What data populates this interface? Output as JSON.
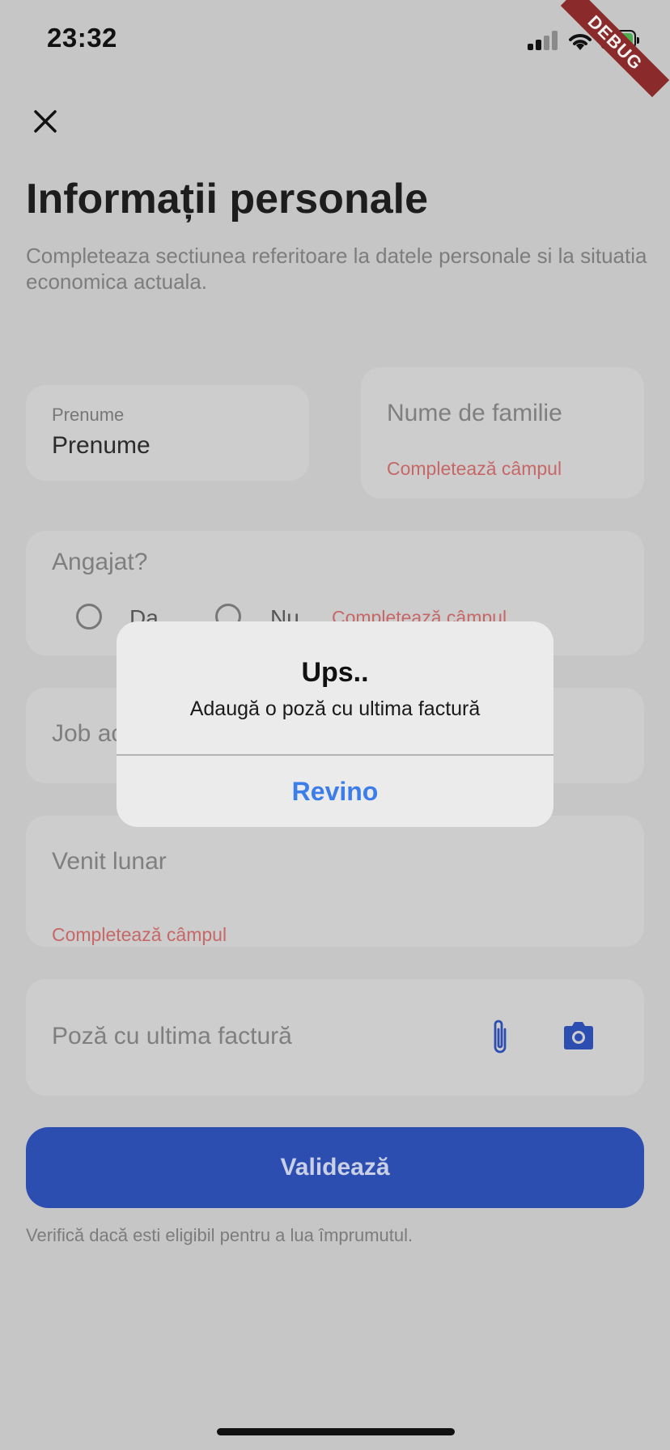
{
  "status_bar": {
    "time": "23:32"
  },
  "debug_banner": "DEBUG",
  "page": {
    "title": "Informații personale",
    "subtitle": "Completeaza sectiunea referitoare la datele personale si la situatia economica actuala."
  },
  "form": {
    "first_name": {
      "label": "Prenume",
      "value": "Prenume"
    },
    "last_name": {
      "placeholder": "Nume de familie",
      "error": "Completează câmpul"
    },
    "employed": {
      "label": "Angajat?",
      "option_yes": "Da",
      "option_no": "Nu",
      "error": "Completează câmpul"
    },
    "job": {
      "placeholder": "Job actual"
    },
    "monthly_income": {
      "placeholder": "Venit lunar",
      "error": "Completează câmpul"
    },
    "invoice_photo": {
      "placeholder": "Poză cu ultima factură",
      "attach_icon": "paperclip-icon",
      "camera_icon": "camera-icon"
    }
  },
  "actions": {
    "validate_label": "Validează",
    "footnote": "Verifică dacă esti eligibil pentru a lua împrumutul."
  },
  "dialog": {
    "title": "Ups..",
    "message": "Adaugă o poză cu ultima factură",
    "button": "Revino"
  },
  "colors": {
    "primary": "#2d4eb1",
    "error": "#c76767",
    "dialog_action": "#3b7de9"
  }
}
